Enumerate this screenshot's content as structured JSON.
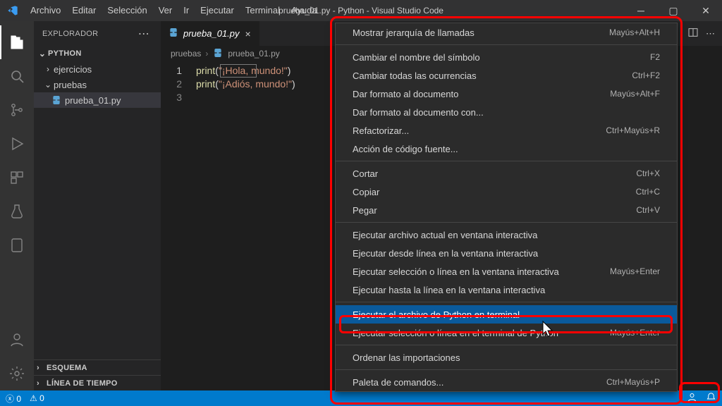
{
  "window": {
    "title": "prueba_01.py - Python - Visual Studio Code"
  },
  "menubar": [
    "Archivo",
    "Editar",
    "Selección",
    "Ver",
    "Ir",
    "Ejecutar",
    "Terminal",
    "Ayuda"
  ],
  "explorer": {
    "title": "EXPLORADOR",
    "rootName": "PYTHON",
    "folders": [
      {
        "name": "ejercicios",
        "expanded": false
      },
      {
        "name": "pruebas",
        "expanded": true,
        "files": [
          {
            "name": "prueba_01.py",
            "selected": true
          }
        ]
      }
    ],
    "collapsed": [
      {
        "label": "ESQUEMA"
      },
      {
        "label": "LÍNEA DE TIEMPO"
      }
    ]
  },
  "tab": {
    "label": "prueba_01.py"
  },
  "breadcrumb": {
    "folder": "pruebas",
    "file": "prueba_01.py"
  },
  "code": {
    "lines": [
      {
        "n": "1",
        "fn": "print",
        "open": "(",
        "str": "\"¡Hola, mundo!\"",
        "close": ")"
      },
      {
        "n": "2",
        "fn": "print",
        "open": "(",
        "str": "\"¡Adiós, mundo!\"",
        "close": ")"
      },
      {
        "n": "3",
        "fn": "",
        "open": "",
        "str": "",
        "close": ""
      }
    ]
  },
  "contextMenu": {
    "groups": [
      [
        {
          "label": "Mostrar jerarquía de llamadas",
          "shortcut": "Mayús+Alt+H"
        }
      ],
      [
        {
          "label": "Cambiar el nombre del símbolo",
          "shortcut": "F2"
        },
        {
          "label": "Cambiar todas las ocurrencias",
          "shortcut": "Ctrl+F2"
        },
        {
          "label": "Dar formato al documento",
          "shortcut": "Mayús+Alt+F"
        },
        {
          "label": "Dar formato al documento con..."
        },
        {
          "label": "Refactorizar...",
          "shortcut": "Ctrl+Mayús+R"
        },
        {
          "label": "Acción de código fuente..."
        }
      ],
      [
        {
          "label": "Cortar",
          "shortcut": "Ctrl+X"
        },
        {
          "label": "Copiar",
          "shortcut": "Ctrl+C"
        },
        {
          "label": "Pegar",
          "shortcut": "Ctrl+V"
        }
      ],
      [
        {
          "label": "Ejecutar archivo actual en ventana interactiva"
        },
        {
          "label": "Ejecutar desde línea en la ventana interactiva"
        },
        {
          "label": "Ejecutar selección o línea en la ventana interactiva",
          "shortcut": "Mayús+Enter"
        },
        {
          "label": "Ejecutar hasta la línea en la ventana interactiva"
        }
      ],
      [
        {
          "label": "Ejecutar el archivo de Python en terminal",
          "highlight": true
        },
        {
          "label": "Ejecutar selección o línea en el terminal de Python",
          "shortcut": "Mayús+Enter"
        }
      ],
      [
        {
          "label": "Ordenar las importaciones"
        }
      ],
      [
        {
          "label": "Paleta de comandos...",
          "shortcut": "Ctrl+Mayús+P"
        }
      ]
    ]
  },
  "status": {
    "errors": "0",
    "warnings": "0"
  }
}
